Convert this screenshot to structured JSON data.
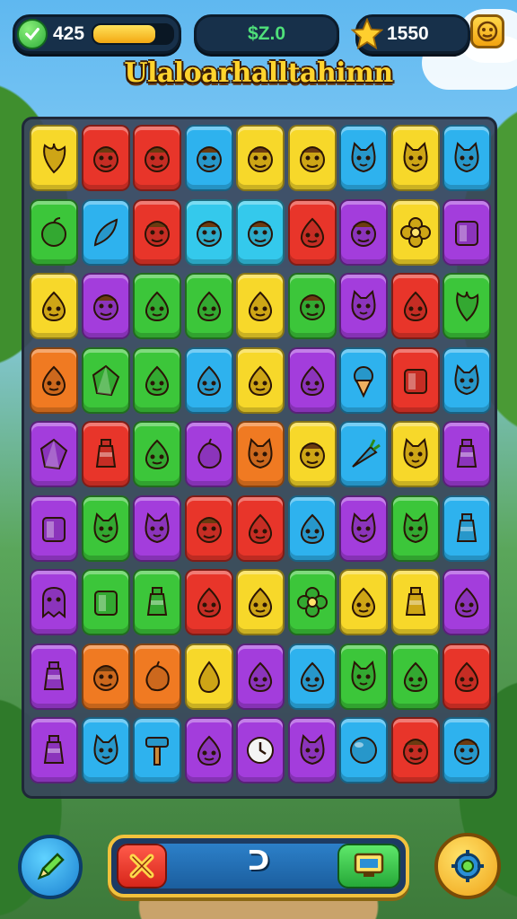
{
  "hud": {
    "lives": {
      "value": "425",
      "energy_fraction": 0.78,
      "icon": "check-icon"
    },
    "coins": {
      "value": "$Z.0"
    },
    "stars": {
      "value": "1550",
      "icon": "star-icon"
    },
    "menu_icon": "monkey-face-icon"
  },
  "title": "Ulaloarhalltahimn",
  "board": {
    "rows": 9,
    "cols": 9,
    "tiles": [
      [
        "yellow:leaf-icon",
        "red:monster-icon",
        "red:monster-icon",
        "blue:monster-icon",
        "yellow:monster-icon",
        "yellow:monster-icon",
        "blue:cat-icon",
        "yellow:cat-icon",
        "blue:cat-icon"
      ],
      [
        "green:apple-icon",
        "blue:feather-icon",
        "red:monster-icon",
        "cyan:monster-icon",
        "cyan:monster-icon",
        "red:creature-icon",
        "purple:monster-icon",
        "yellow:flower-icon",
        "purple:block-icon"
      ],
      [
        "yellow:creature-icon",
        "purple:monster-icon",
        "green:creature-icon",
        "green:creature-icon",
        "yellow:creature-icon",
        "green:monster-icon",
        "purple:cat-icon",
        "red:creature-icon",
        "green:leaf-icon"
      ],
      [
        "orange:creature-icon",
        "green:crystal-icon",
        "green:creature-icon",
        "blue:creature-icon",
        "yellow:creature-icon",
        "purple:creature-icon",
        "blue:icecream-icon",
        "red:block-icon",
        "blue:cat-icon"
      ],
      [
        "purple:crystal-icon",
        "red:potion-icon",
        "green:creature-icon",
        "purple:fruit-icon",
        "orange:cat-icon",
        "yellow:monster-icon",
        "blue:carrot-icon",
        "yellow:cat-icon",
        "purple:potion-icon"
      ],
      [
        "purple:block-icon",
        "green:cat-icon",
        "purple:cat-icon",
        "red:monster-icon",
        "red:creature-icon",
        "blue:creature-icon",
        "purple:cat-icon",
        "green:cat-icon",
        "blue:potion-icon"
      ],
      [
        "purple:ghost-icon",
        "green:block-icon",
        "green:potion-icon",
        "red:creature-icon",
        "yellow:creature-icon",
        "green:flower-icon",
        "yellow:creature-icon",
        "yellow:potion-icon",
        "purple:creature-icon"
      ],
      [
        "purple:potion-icon",
        "orange:monster-icon",
        "orange:fruit-icon",
        "yellow:drop-icon",
        "purple:creature-icon",
        "blue:creature-icon",
        "green:cat-icon",
        "green:creature-icon",
        "red:creature-icon"
      ],
      [
        "purple:potion-icon",
        "blue:cat-icon",
        "blue:hammer-icon",
        "purple:creature-icon",
        "purple:clock-icon",
        "purple:cat-icon",
        "blue:orb-icon",
        "red:monster-icon",
        "blue:monster-icon"
      ]
    ]
  },
  "bottom": {
    "left_button_icon": "pencil-icon",
    "cancel_icon": "cross-icon",
    "move_count": "ᑐ",
    "confirm_icon": "screen-icon",
    "right_button_icon": "gear-icon"
  },
  "colors": {
    "red": "#e8352a",
    "green": "#3cc63a",
    "blue": "#2eb2ee",
    "yellow": "#f7d82a",
    "purple": "#a33ddc",
    "orange": "#f07a22",
    "cyan": "#34c9ec"
  }
}
